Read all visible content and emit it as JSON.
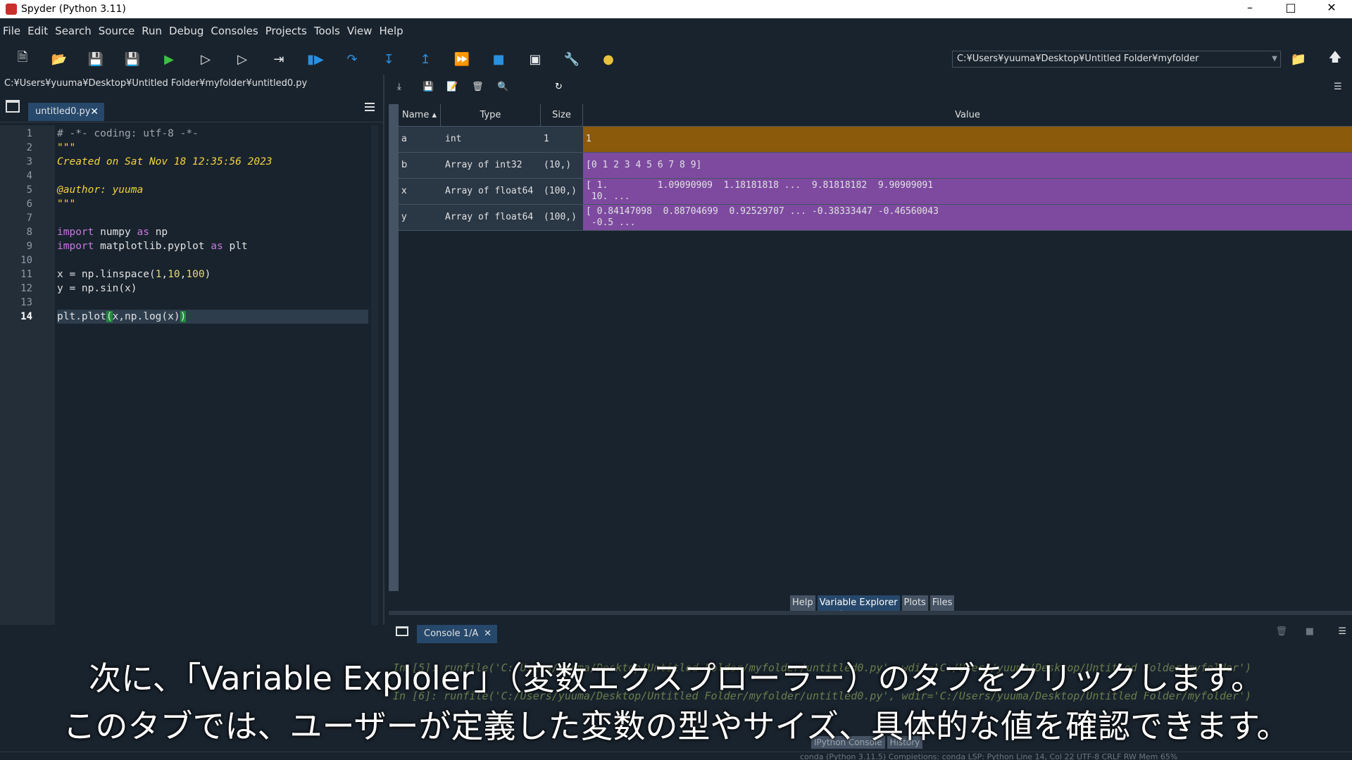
{
  "window": {
    "title": "Spyder (Python 3.11)"
  },
  "menu": [
    "File",
    "Edit",
    "Search",
    "Source",
    "Run",
    "Debug",
    "Consoles",
    "Projects",
    "Tools",
    "View",
    "Help"
  ],
  "toolbar": {
    "icons": [
      "new-file-icon",
      "open-file-icon",
      "save-icon",
      "save-all-icon",
      "run-icon",
      "run-cell-icon",
      "run-cell-advance-icon",
      "run-selection-icon",
      "debug-icon",
      "step-icon",
      "step-into-icon",
      "step-return-icon",
      "continue-icon",
      "stop-icon",
      "maximize-pane-icon",
      "preferences-icon",
      "python-path-icon"
    ],
    "working_directory": "C:¥Users¥yuuma¥Desktop¥Untitled Folder¥myfolder"
  },
  "editor": {
    "file_path": "C:¥Users¥yuuma¥Desktop¥Untitled Folder¥myfolder¥untitled0.py",
    "tab_label": "untitled0.py",
    "current_line": 14,
    "lines": [
      "# -*- coding: utf-8 -*-",
      "\"\"\"",
      "Created on Sat Nov 18 12:35:56 2023",
      "",
      "@author: yuuma",
      "\"\"\"",
      "",
      "import numpy as np",
      "import matplotlib.pyplot as plt",
      "",
      "x = np.linspace(1,10,100)",
      "y = np.sin(x)",
      "",
      "plt.plot(x,np.log(x))"
    ]
  },
  "variable_explorer": {
    "columns": [
      "Name",
      "Type",
      "Size",
      "Value"
    ],
    "rows": [
      {
        "name": "a",
        "type": "int",
        "size": "1",
        "value": "1",
        "color": "#8b5a0b"
      },
      {
        "name": "b",
        "type": "Array of int32",
        "size": "(10,)",
        "value": "[0 1 2 3 4 5 6 7 8 9]",
        "color": "#7e4aa0"
      },
      {
        "name": "x",
        "type": "Array of float64",
        "size": "(100,)",
        "value": "[ 1.         1.09090909  1.18181818 ...  9.81818182  9.90909091\n 10. ...",
        "color": "#7e4aa0"
      },
      {
        "name": "y",
        "type": "Array of float64",
        "size": "(100,)",
        "value": "[ 0.84147098  0.88704699  0.92529707 ... -0.38333447 -0.46560043\n -0.5 ...",
        "color": "#7e4aa0"
      }
    ]
  },
  "pane_tabs": [
    "Help",
    "Variable Explorer",
    "Plots",
    "Files"
  ],
  "active_pane_tab": "Variable Explorer",
  "console": {
    "tab_label": "Console 1/A",
    "lines": [
      "In [5]: runfile('C:/Users/yuuma/Desktop/Untitled Folder/myfolder/untitled0.py', wdir='C:/Users/yuuma/Desktop/Untitled Folder/myfolder')",
      "In [6]: runfile('C:/Users/yuuma/Desktop/Untitled Folder/myfolder/untitled0.py', wdir='C:/Users/yuuma/Desktop/Untitled Folder/myfolder')"
    ],
    "bottom_tabs": [
      "IPython Console",
      "History"
    ]
  },
  "status_bar": "conda (Python 3.11.5)   Completions: conda   LSP: Python   Line 14, Col 22   UTF-8   CRLF   RW   Mem 65%",
  "subtitle": {
    "line1": "次に、「Variable Exploler」（変数エクスプローラー）のタブをクリックします。",
    "line2": "このタブでは、ユーザーが定義した変数の型やサイズ、具体的な値を確認できます。"
  }
}
